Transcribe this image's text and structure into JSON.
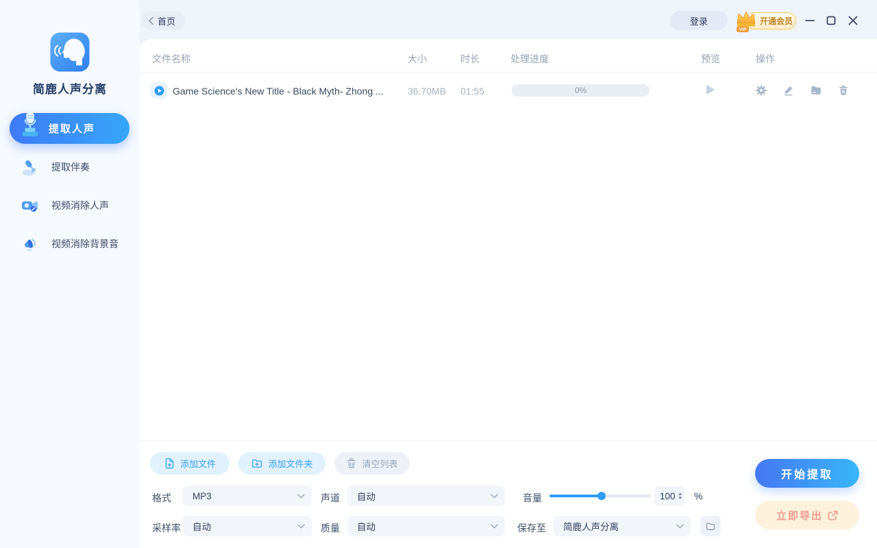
{
  "app": {
    "name": "简鹿人声分离"
  },
  "topbar": {
    "back": "首页",
    "login": "登录",
    "vip_badge": "VIP",
    "vip_label": "开通会员"
  },
  "sidebar": {
    "items": [
      {
        "label": "提取人声",
        "active": true
      },
      {
        "label": "提取伴奏",
        "active": false
      },
      {
        "label": "视频消除人声",
        "active": false
      },
      {
        "label": "视频消除背景音",
        "active": false
      }
    ]
  },
  "table": {
    "headers": {
      "name": "文件名称",
      "size": "大小",
      "duration": "时长",
      "progress": "处理进度",
      "preview": "预览",
      "actions": "操作"
    },
    "rows": [
      {
        "name": "Game Science's New Title - Black Myth- Zhong ...",
        "size": "36.70MB",
        "duration": "01:55",
        "progress_text": "0%",
        "progress_percent": 0
      }
    ]
  },
  "toolbar": {
    "add_file": "添加文件",
    "add_folder": "添加文件夹",
    "clear_list": "清空列表"
  },
  "settings": {
    "format": {
      "label": "格式",
      "value": "MP3"
    },
    "channel": {
      "label": "声道",
      "value": "自动"
    },
    "volume": {
      "label": "音量",
      "value": "100",
      "unit": "%"
    },
    "sample_rate": {
      "label": "采样率",
      "value": "自动"
    },
    "quality": {
      "label": "质量",
      "value": "自动"
    },
    "save_to": {
      "label": "保存至",
      "value": "简鹿人声分离"
    }
  },
  "actions": {
    "start": "开始提取",
    "export": "立即导出"
  },
  "colors": {
    "accent": "#2f9df8",
    "active_gradient_start": "#3e7bf6",
    "active_gradient_end": "#36a6f9",
    "start_gradient_start": "#4577f3",
    "start_gradient_end": "#38b6f9",
    "vip_gold_border": "#f3cd5e",
    "vip_text": "#c08a2e",
    "export_bg": "#fcf2db",
    "export_text": "#f19b90",
    "progress_track": "#e9edf4",
    "sidebar_bg": "#f6f9fe",
    "topbar_bg": "#eff3fa"
  }
}
